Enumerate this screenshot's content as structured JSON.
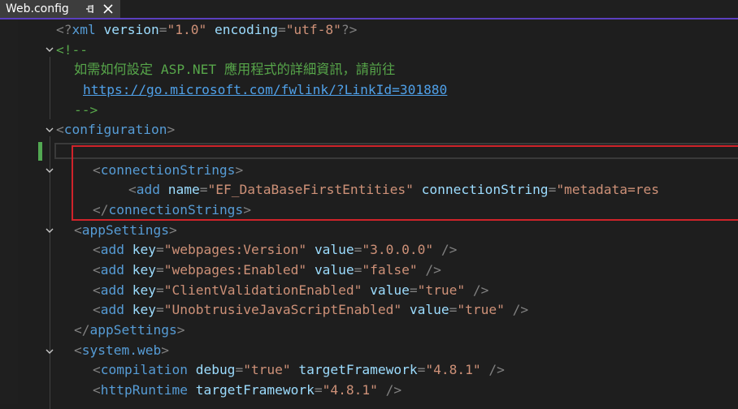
{
  "tab": {
    "title": "Web.config"
  },
  "colors": {
    "tab_accent": "#5b3fbf",
    "highlight_box": "#d0232a",
    "change_marker": "#52a852"
  },
  "icons": {
    "pin": "pin-icon",
    "close": "close-icon",
    "fold": "chevron-down-icon"
  },
  "code": {
    "xml_decl": {
      "open": "<?",
      "name": "xml",
      "attr1": "version",
      "val1": "\"1.0\"",
      "attr2": "encoding",
      "val2": "\"utf-8\"",
      "close": "?>"
    },
    "comment_open": "<!--",
    "comment_text": "如需如何設定 ASP.NET 應用程式的詳細資訊，請前往",
    "comment_link": "https://go.microsoft.com/fwlink/?LinkId=301880",
    "comment_close": "-->",
    "configuration_tag": "configuration",
    "connection_strings_tag": "connectionStrings",
    "add_tag": "add",
    "conn_add": {
      "attr1": "name",
      "val1": "\"EF_DataBaseFirstEntities\"",
      "attr2": "connectionString",
      "val2_visible": "\"metadata=res"
    },
    "app_settings_tag": "appSettings",
    "app_settings": [
      {
        "key_attr": "key",
        "key": "\"webpages:Version\"",
        "value_attr": "value",
        "value": "\"3.0.0.0\""
      },
      {
        "key_attr": "key",
        "key": "\"webpages:Enabled\"",
        "value_attr": "value",
        "value": "\"false\""
      },
      {
        "key_attr": "key",
        "key": "\"ClientValidationEnabled\"",
        "value_attr": "value",
        "value": "\"true\""
      },
      {
        "key_attr": "key",
        "key": "\"UnobtrusiveJavaScriptEnabled\"",
        "value_attr": "value",
        "value": "\"true\""
      }
    ],
    "system_web_tag": "system.web",
    "compilation": {
      "tag": "compilation",
      "attr1": "debug",
      "val1": "\"true\"",
      "attr2": "targetFramework",
      "val2": "\"4.8.1\""
    },
    "http_runtime": {
      "tag": "httpRuntime",
      "attr1": "targetFramework",
      "val1": "\"4.8.1\""
    }
  }
}
